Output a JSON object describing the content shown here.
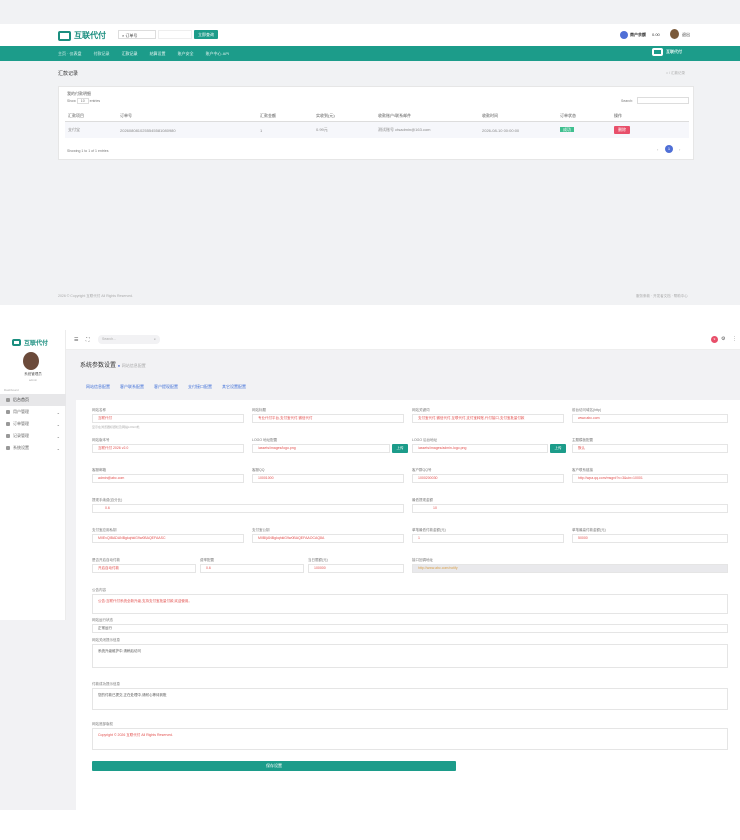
{
  "top": {
    "brand": "互联代付",
    "search_select": "订单号",
    "search_btn": "立即查询",
    "user_label": "商户余额",
    "user_value": "0.00",
    "user_name": "退出",
    "nav": [
      "主页 · 仪表盘",
      "付款记录",
      "汇款记录",
      "结算设置",
      "账户安全",
      "账户中心 API"
    ],
    "page_title": "汇款记录",
    "breadcrumb": "汇款记录",
    "card_title": "我的付款明细",
    "show_label": "Show",
    "show_value": "10",
    "entries_label": "entries",
    "search_label": "Search:",
    "columns": [
      "汇款项目",
      "订单号",
      "汇款金额",
      "实收到(元)",
      "收款账户/联系邮件",
      "收款时间",
      "订单状态",
      "操作"
    ],
    "row": {
      "project": "支付宝",
      "order": "2026080810255545581080980",
      "amount": "1",
      "received": "0.99元",
      "account": "测试账号 ctsadmin@163.com",
      "time": "2026-08-10 00:00:00",
      "status": "成功",
      "action": "删除"
    },
    "showing": "Showing 1 to 1 of 1 entries",
    "page_num": "1",
    "footer_left": "2026 © Copyright 互联代付 All Rights Reserved.",
    "footer_right": "服务条款 · 开发者文档 · 帮助中心"
  },
  "admin": {
    "brand": "互联代付",
    "search_placeholder": "Search...",
    "user_name": "系统管理员",
    "user_role": "admin",
    "menu_title": "Dashboard",
    "menu": [
      "后台首页",
      "用户管理",
      "订单管理",
      "记录管理",
      "系统设置"
    ],
    "badge": "9",
    "page_title": "系统参数设置",
    "subtitle": "网站信息配置",
    "tabs": [
      "网站信息配置",
      "客户联系配置",
      "客户提现配置",
      "支付接口配置",
      "其它设置配置"
    ],
    "fields": {
      "site_name_label": "网站名称",
      "site_name": "互联代付",
      "site_name_hint": "显示在浏览器标题栏及网站LOGO处",
      "title_label": "网站标题",
      "title": "专业代付平台,支付宝代付,微信代付",
      "keywords_label": "网站关键词",
      "keywords": "支付宝代付,微信代付,互联代付,支付宝转账,代付接口,支付宝批量付款",
      "domain_label": "前台访问域名(http)",
      "domain": "www.abc.com",
      "desc_label": "网站版本号",
      "desc": "互联代付 2026 v2.0",
      "logo_label": "LOGO 地址配置",
      "logo": "/assets/images/logo.png",
      "upload1": "上传",
      "logo2_label": "LOGO 后台地址",
      "logo2": "/assets/images/admin-logo.png",
      "upload2": "上传",
      "theme_label": "主题模板配置",
      "theme": "默认",
      "email_label": "客服邮箱",
      "email": "admin@abc.com",
      "qq_label": "客服QQ",
      "qq": "10001000",
      "phone_label": "客户群QQ号",
      "phone": "1000200030",
      "wx_label": "客户联系链接",
      "wx": "http://wpa.qq.com/msgrd?v=3&uin=10001",
      "fee1_label": "提现手续费(百分比)",
      "fee1": "0.6",
      "fee2_label": "最低提现金额",
      "fee2": "10",
      "api_label": "支付宝应用私钥",
      "api": "MIIEvQIBADANBgkqhkiG9w0BAQEFAASC",
      "api2_label": "支付宝公钥",
      "api2": "MIIBIjANBgkqhkiG9w0BAQEFAAOCAQ8A",
      "min_label": "单笔最低付款金额(元)",
      "min": "1",
      "max_label": "单笔最高付款金额(元)",
      "max": "50000",
      "mode_label": "是否开启自动付款",
      "mode": "开启自动付款",
      "rate_label": "费率配置",
      "rate": "0.6",
      "limit_label": "当日限额(元)",
      "limit": "100000",
      "appid_label": "接口回调地址",
      "appid": "http://www.abc.com/notify",
      "notice_label": "公告内容",
      "notice": "公告:互联代付系统全新升级,支持支付宝批量付款,欢迎使用。",
      "status_label": "网站运行状态",
      "status": "正常运行",
      "close_label": "网站关闭提示信息",
      "close": "系统升级维护中,请稍后访问",
      "foot_label": "付款成功提示信息",
      "foot": "您的付款已提交,正在处理中,请耐心等待到账",
      "copy_label": "网站底部版权",
      "copy": "Copyright © 2026 互联代付 All Rights Reserved.",
      "save": "保存设置"
    }
  }
}
